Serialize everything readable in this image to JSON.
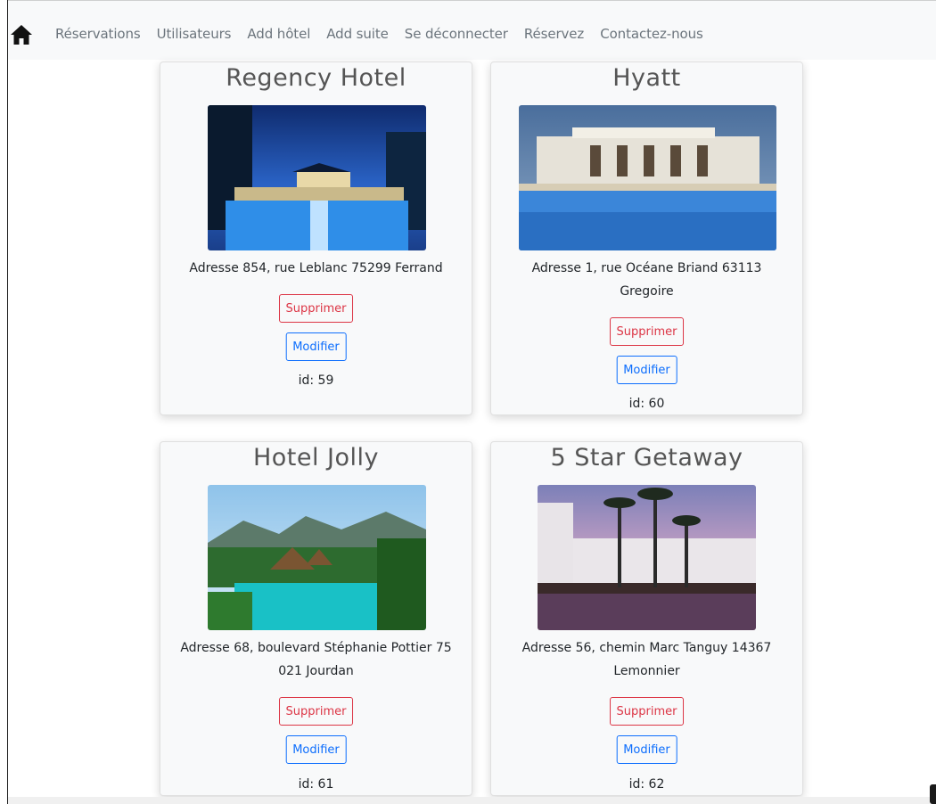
{
  "nav": {
    "home_icon": "home-icon",
    "links": [
      "Réservations",
      "Utilisateurs",
      "Add hôtel",
      "Add suite",
      "Se déconnecter",
      "Réservez",
      "Contactez-nous"
    ]
  },
  "hotels": [
    {
      "name": "Regency Hotel",
      "address": "Adresse 854, rue Leblanc 75299 Ferrand",
      "delete_label": "Supprimer",
      "edit_label": "Modifier",
      "id_label": "id: 59"
    },
    {
      "name": "Hyatt",
      "address": "Adresse 1, rue Océane Briand 63113 Gregoire",
      "delete_label": "Supprimer",
      "edit_label": "Modifier",
      "id_label": "id: 60"
    },
    {
      "name": "Hotel Jolly",
      "address": "Adresse 68, boulevard Stéphanie Pottier 75 021 Jourdan",
      "delete_label": "Supprimer",
      "edit_label": "Modifier",
      "id_label": "id: 61"
    },
    {
      "name": "5 Star Getaway",
      "address": "Adresse 56, chemin Marc Tanguy 14367 Lemonnier",
      "delete_label": "Supprimer",
      "edit_label": "Modifier",
      "id_label": "id: 62"
    }
  ],
  "colors": {
    "navbar_bg": "#f8f9fa",
    "nav_link": "#6c757d",
    "danger": "#dc3545",
    "primary": "#0d6efd",
    "card_bg": "#f8f9fa"
  }
}
